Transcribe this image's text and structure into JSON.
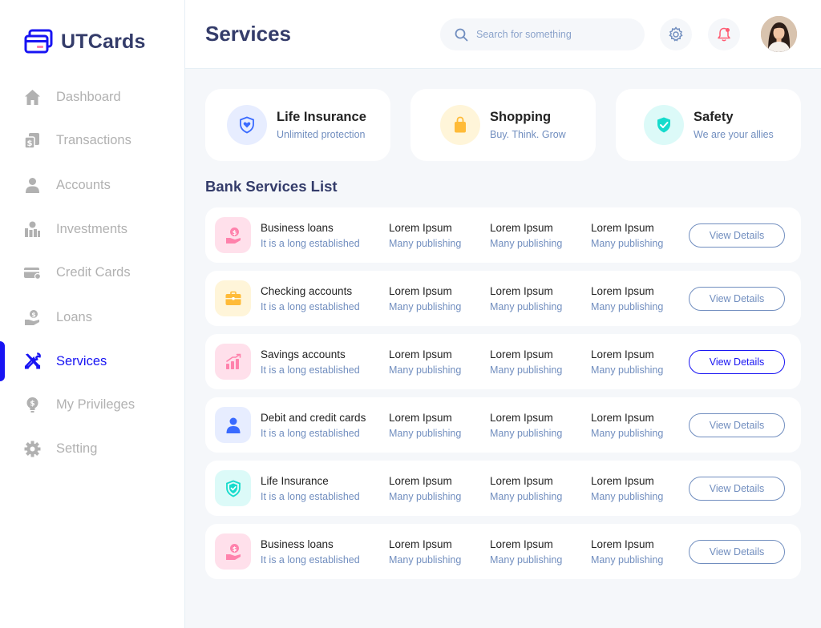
{
  "app": {
    "name": "UTCards"
  },
  "sidebar": {
    "items": [
      {
        "label": "Dashboard",
        "icon": "home-icon"
      },
      {
        "label": "Transactions",
        "icon": "transfer-icon"
      },
      {
        "label": "Accounts",
        "icon": "user-icon"
      },
      {
        "label": "Investments",
        "icon": "economic-investment-icon"
      },
      {
        "label": "Credit Cards",
        "icon": "credit-card-icon"
      },
      {
        "label": "Loans",
        "icon": "loan-icon"
      },
      {
        "label": "Services",
        "icon": "service-tools-icon",
        "active": true
      },
      {
        "label": "My Privileges",
        "icon": "lightbulb-dollar-icon"
      },
      {
        "label": "Setting",
        "icon": "gear-icon"
      }
    ]
  },
  "header": {
    "title": "Services",
    "search_placeholder": "Search for something"
  },
  "service_cards": [
    {
      "title": "Life Insurance",
      "subtitle": "Unlimited protection",
      "icon": "shield-heart-icon"
    },
    {
      "title": "Shopping",
      "subtitle": "Buy. Think. Grow",
      "icon": "shopping-bag-icon"
    },
    {
      "title": "Safety",
      "subtitle": "We are your allies",
      "icon": "shield-check-icon"
    }
  ],
  "list": {
    "title": "Bank Services List",
    "button_label": "View Details",
    "rows": [
      {
        "title": "Business loans",
        "subtitle": "It is a long established",
        "icon": "hand-coin-icon",
        "cols": [
          [
            "Lorem Ipsum",
            "Many publishing"
          ],
          [
            "Lorem Ipsum",
            "Many publishing"
          ],
          [
            "Lorem Ipsum",
            "Many publishing"
          ]
        ]
      },
      {
        "title": "Checking accounts",
        "subtitle": "It is a long established",
        "icon": "briefcase-icon",
        "cols": [
          [
            "Lorem Ipsum",
            "Many publishing"
          ],
          [
            "Lorem Ipsum",
            "Many publishing"
          ],
          [
            "Lorem Ipsum",
            "Many publishing"
          ]
        ]
      },
      {
        "title": "Savings accounts",
        "subtitle": "It is a long established",
        "icon": "bar-chart-up-icon",
        "cols": [
          [
            "Lorem Ipsum",
            "Many publishing"
          ],
          [
            "Lorem Ipsum",
            "Many publishing"
          ],
          [
            "Lorem Ipsum",
            "Many publishing"
          ]
        ],
        "active": true
      },
      {
        "title": "Debit and credit cards",
        "subtitle": "It is a long established",
        "icon": "user-icon",
        "cols": [
          [
            "Lorem Ipsum",
            "Many publishing"
          ],
          [
            "Lorem Ipsum",
            "Many publishing"
          ],
          [
            "Lorem Ipsum",
            "Many publishing"
          ]
        ]
      },
      {
        "title": "Life Insurance",
        "subtitle": "It is a long established",
        "icon": "shield-check-icon",
        "cols": [
          [
            "Lorem Ipsum",
            "Many publishing"
          ],
          [
            "Lorem Ipsum",
            "Many publishing"
          ],
          [
            "Lorem Ipsum",
            "Many publishing"
          ]
        ]
      },
      {
        "title": "Business loans",
        "subtitle": "It is a long established",
        "icon": "hand-coin-icon",
        "cols": [
          [
            "Lorem Ipsum",
            "Many publishing"
          ],
          [
            "Lorem Ipsum",
            "Many publishing"
          ],
          [
            "Lorem Ipsum",
            "Many publishing"
          ]
        ]
      }
    ]
  },
  "colors": {
    "primary": "#1814f3",
    "title": "#343c6a",
    "muted": "#718ebf",
    "sidebar_inactive": "#b1b1b1",
    "background": "#f5f7fa"
  }
}
